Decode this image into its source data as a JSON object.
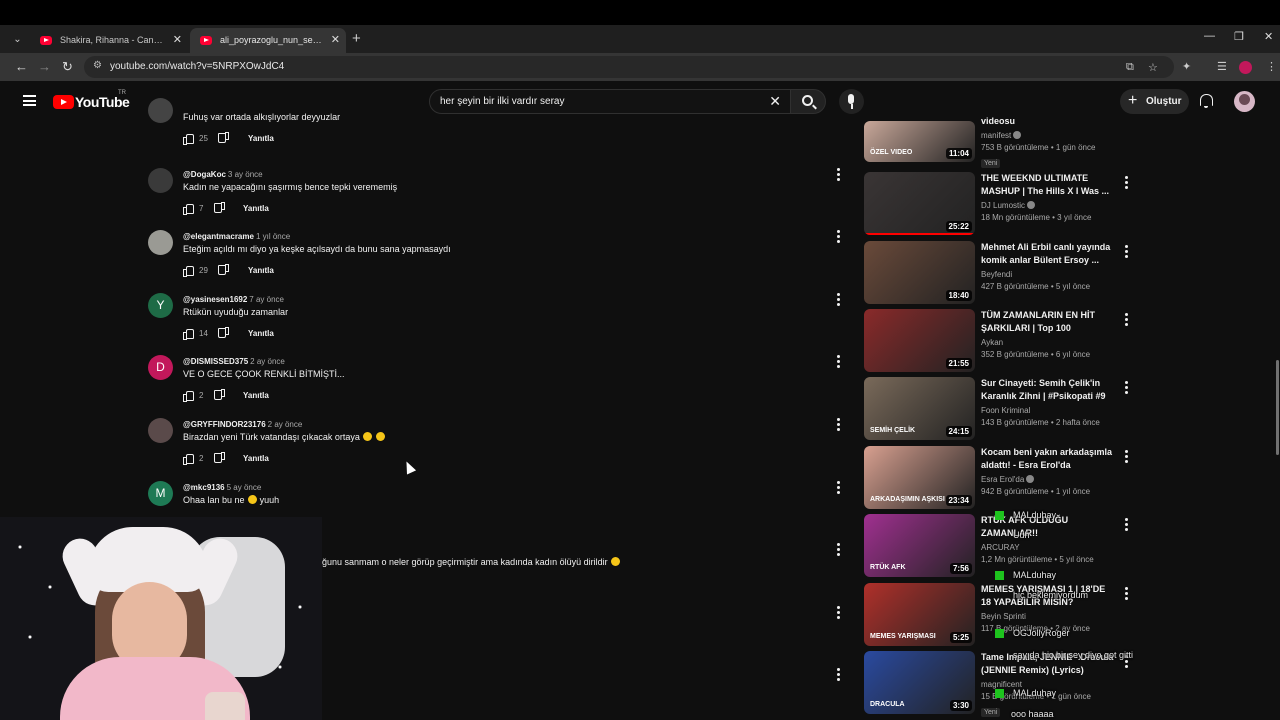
{
  "browser": {
    "tabs": [
      {
        "title": "Shakira, Rihanna - Can't Remem",
        "active": false
      },
      {
        "title": "ali_poyrazoglu_nun_seray_seven",
        "active": true
      }
    ],
    "new_tab": "+",
    "url": "youtube.com/watch?v=5NRPXOwJdC4",
    "controls": {
      "minimize": "—",
      "restore": "❐",
      "close": "✕"
    }
  },
  "header": {
    "logo_text": "YouTube",
    "country": "TR",
    "search_query": "her şeyin bir ilki vardır seray",
    "create_label": "Oluştur"
  },
  "comments": [
    {
      "handle": "",
      "time": "",
      "text": "Fuhuş var ortada alkışlıyorlar deyyuzlar",
      "likes": "25",
      "reply": "Yanıtla",
      "avatar_letter": "",
      "avatar_color": "#444444"
    },
    {
      "handle": "@DogaKoc",
      "time": "3 ay önce",
      "text": "Kadın ne yapacağını şaşırmış bence tepki verememiş",
      "likes": "7",
      "reply": "Yanıtla",
      "avatar_letter": "",
      "avatar_color": "#3a3a3a"
    },
    {
      "handle": "@elegantmacrame",
      "time": "1 yıl önce",
      "text": "Eteğim açıldı mı diyo ya keşke açılsaydı da bunu sana yapmasaydı",
      "likes": "29",
      "reply": "Yanıtla",
      "avatar_letter": "",
      "avatar_color": "#9a9a94"
    },
    {
      "handle": "@yasinesen1692",
      "time": "7 ay önce",
      "text": "Rtükün uyuduğu zamanlar",
      "likes": "14",
      "reply": "Yanıtla",
      "avatar_letter": "Y",
      "avatar_color": "#1e6b46"
    },
    {
      "handle": "@DISMISSED375",
      "time": "2 ay önce",
      "text": "VE O GECE ÇOOK RENKLİ BİTMİŞTİ...",
      "likes": "2",
      "reply": "Yanıtla",
      "avatar_letter": "D",
      "avatar_color": "#c2185b"
    },
    {
      "handle": "@GRYFFINDOR23176",
      "time": "2 ay önce",
      "text": "Birazdan yeni Türk vatandaşı çıkacak ortaya",
      "likes": "2",
      "reply": "Yanıtla",
      "avatar_letter": "",
      "avatar_color": "#5a4a4a"
    },
    {
      "handle": "@mkc9136",
      "time": "5 ay önce",
      "text": "Ohaa lan bu ne",
      "text_suffix": "yuuh",
      "likes": "",
      "reply": "",
      "avatar_letter": "M",
      "avatar_color": "#1e7a55"
    }
  ],
  "cutoff_comment": "ğunu sanmam o neler görüp geçirmiştir ama kadında kadın ölüyü dirildir",
  "sidebar": [
    {
      "title": "videosu",
      "channel": "manifest",
      "verified": true,
      "meta": "753 B görüntüleme • 1 gün önce",
      "badge": "Yeni",
      "duration": "11:04",
      "thumb_label": "ÖZEL VIDEO",
      "thumb_color": "#c9a89a",
      "progress": 0
    },
    {
      "title": "THE WEEKND ULTIMATE MASHUP | The Hills X I Was ...",
      "channel": "DJ Lumostic",
      "verified": true,
      "meta": "18 Mn görüntüleme • 3 yıl önce",
      "badge": "",
      "duration": "25:22",
      "thumb_label": "",
      "thumb_color": "#3a3535",
      "progress": 1.0
    },
    {
      "title": "Mehmet Ali Erbil  canlı yayında komik anlar  Bülent Ersoy ...",
      "channel": "Beyfendi",
      "verified": false,
      "meta": "427 B görüntüleme • 5 yıl önce",
      "badge": "",
      "duration": "18:40",
      "thumb_label": "",
      "thumb_color": "#6a4a3a",
      "progress": 0
    },
    {
      "title": "TÜM ZAMANLARIN EN HİT ŞARKILARI |  Top 100",
      "channel": "Aykan",
      "verified": false,
      "meta": "352 B görüntüleme • 6 yıl önce",
      "badge": "",
      "duration": "21:55",
      "thumb_label": "",
      "thumb_color": "#8a2a2a",
      "progress": 0
    },
    {
      "title": "Sur Cinayeti: Semih Çelik'in Karanlık Zihni | #Psikopati #9",
      "channel": "Foon Kriminal",
      "verified": false,
      "meta": "143 B görüntüleme • 2 hafta önce",
      "badge": "",
      "duration": "24:15",
      "thumb_label": "SEMİH ÇELİK",
      "thumb_color": "#7a6a5a",
      "progress": 0
    },
    {
      "title": "Kocam beni yakın arkadaşımla aldattı! - Esra Erol'da",
      "channel": "Esra Erol'da",
      "verified": true,
      "meta": "942 B görüntüleme • 1 yıl önce",
      "badge": "",
      "duration": "23:34",
      "thumb_label": "ARKADAŞIMIN AŞKISI",
      "thumb_color": "#d8a090",
      "progress": 0
    },
    {
      "title": "RTÜK AFK OLDUĞU ZAMANLAR!!",
      "channel": "ARCURAY",
      "verified": false,
      "meta": "1,2 Mn görüntüleme • 5 yıl önce",
      "badge": "",
      "duration": "7:56",
      "thumb_label": "RTÜK AFK",
      "thumb_color": "#a03090",
      "progress": 0
    },
    {
      "title": "MEMES YARIŞMASI 1 | 18'DE 18 YAPABİLİR MİSİN?",
      "channel": "Beyin Sprinti",
      "verified": false,
      "meta": "117 B görüntüleme • 2 ay önce",
      "badge": "",
      "duration": "5:25",
      "thumb_label": "MEMES YARIŞMASI",
      "thumb_color": "#b0302a",
      "progress": 0
    },
    {
      "title": "Tame Impala, JENNIE - Dracula (JENNIE Remix) (Lyrics)",
      "channel": "magnificent",
      "verified": false,
      "meta": "15 B görüntüleme • 1 gün önce",
      "badge": "Yeni",
      "duration": "3:30",
      "thumb_label": "DRACULA",
      "thumb_color": "#2a4aa0",
      "progress": 0
    }
  ],
  "chat": [
    {
      "user": "MALduhay",
      "message": ""
    },
    {
      "user": "",
      "message": "Uuh"
    },
    {
      "user": "MALduhay",
      "message": ""
    },
    {
      "user": "",
      "message": "hiç beklemiyordum"
    },
    {
      "user": "OGJollyRoger",
      "message": ""
    },
    {
      "user": "",
      "message": "sayıda hiç bir şey diyo got gitti"
    },
    {
      "user": "MALduhay",
      "message": ""
    },
    {
      "user": "",
      "message": "ooo haaaa"
    }
  ],
  "colors": {
    "background": "#0f0f0f",
    "accent": "#ff0000",
    "chat_badge": "#1ec31e"
  }
}
